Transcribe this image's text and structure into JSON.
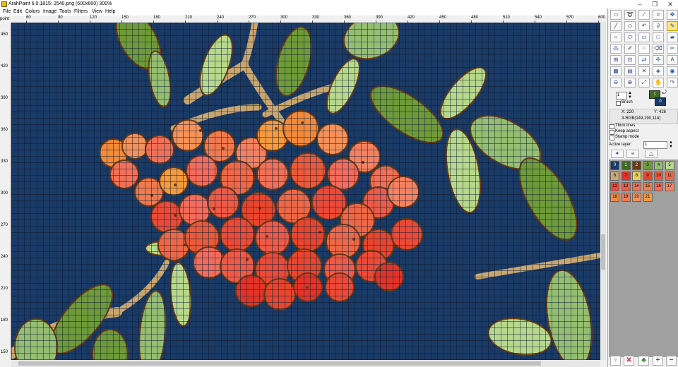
{
  "window": {
    "title": "ArahPaint 6.0.1815: 2540.png  (600x600) 300%",
    "minimize": "–",
    "maximize": "❐",
    "close": "✕"
  },
  "menu": [
    "File",
    "Edit",
    "Colors",
    "Image",
    "Tools",
    "Filters",
    "View",
    "Help"
  ],
  "ruler": {
    "unit": "point",
    "x_ticks": [
      "60",
      "90",
      "120",
      "150",
      "180",
      "210",
      "240",
      "270",
      "300",
      "330",
      "360",
      "390",
      "420",
      "450",
      "480",
      "510",
      "540",
      "570",
      "600"
    ],
    "y_ticks": [
      "450",
      "420",
      "390",
      "360",
      "330",
      "300",
      "270",
      "240",
      "210",
      "180",
      "150"
    ]
  },
  "panel": {
    "brush_size": "1",
    "brush_label": "Brush",
    "fg_index": "1",
    "bg_index": "0",
    "x_label": "X: 220",
    "y_label": "Y: 426",
    "rgb_readout": "3-RGB(149,190,114)",
    "thick_lines": "Thick lines",
    "keep_aspect": "Keep aspect",
    "stamp_mode": "Stamp mode",
    "active_layer_label": "Active layer:",
    "active_layer_value": "1"
  },
  "palette": [
    {
      "index": "0",
      "color": "#1a3a66"
    },
    {
      "index": "1",
      "color": "#3f6b1f"
    },
    {
      "index": "2",
      "color": "#6b3a14"
    },
    {
      "index": "3",
      "color": "#6e9a3a"
    },
    {
      "index": "4",
      "color": "#95be72"
    },
    {
      "index": "5",
      "color": "#b7d88c"
    },
    {
      "index": "6",
      "color": "#c8a670"
    },
    {
      "index": "7",
      "color": "#e0342a"
    },
    {
      "index": "8",
      "color": "#e8cf50"
    },
    {
      "index": "9",
      "color": "#e8452e"
    },
    {
      "index": "10",
      "color": "#e85a3c"
    },
    {
      "index": "11",
      "color": "#ec6848"
    },
    {
      "index": "12",
      "color": "#ea4a38"
    },
    {
      "index": "13",
      "color": "#ee5a48"
    },
    {
      "index": "14",
      "color": "#f07058"
    },
    {
      "index": "15",
      "color": "#ea7e52"
    },
    {
      "index": "16",
      "color": "#f26b5c"
    },
    {
      "index": "17",
      "color": "#f48262"
    },
    {
      "index": "18",
      "color": "#f08a3c"
    },
    {
      "index": "19",
      "color": "#ef7a50"
    },
    {
      "index": "20",
      "color": "#f3925a"
    },
    {
      "index": "21",
      "color": "#f49a40"
    }
  ],
  "colors": {
    "canvas_bg": "#1a3a66",
    "grid": "#0c1a30",
    "leaf": "#6e9a3a",
    "leaf_light": "#95be72",
    "leaf_pale": "#b7d88c",
    "stem": "#c8a670",
    "outline": "#6b3a14",
    "berry_red": "#e8452e",
    "berry_orange": "#f08a3c"
  }
}
